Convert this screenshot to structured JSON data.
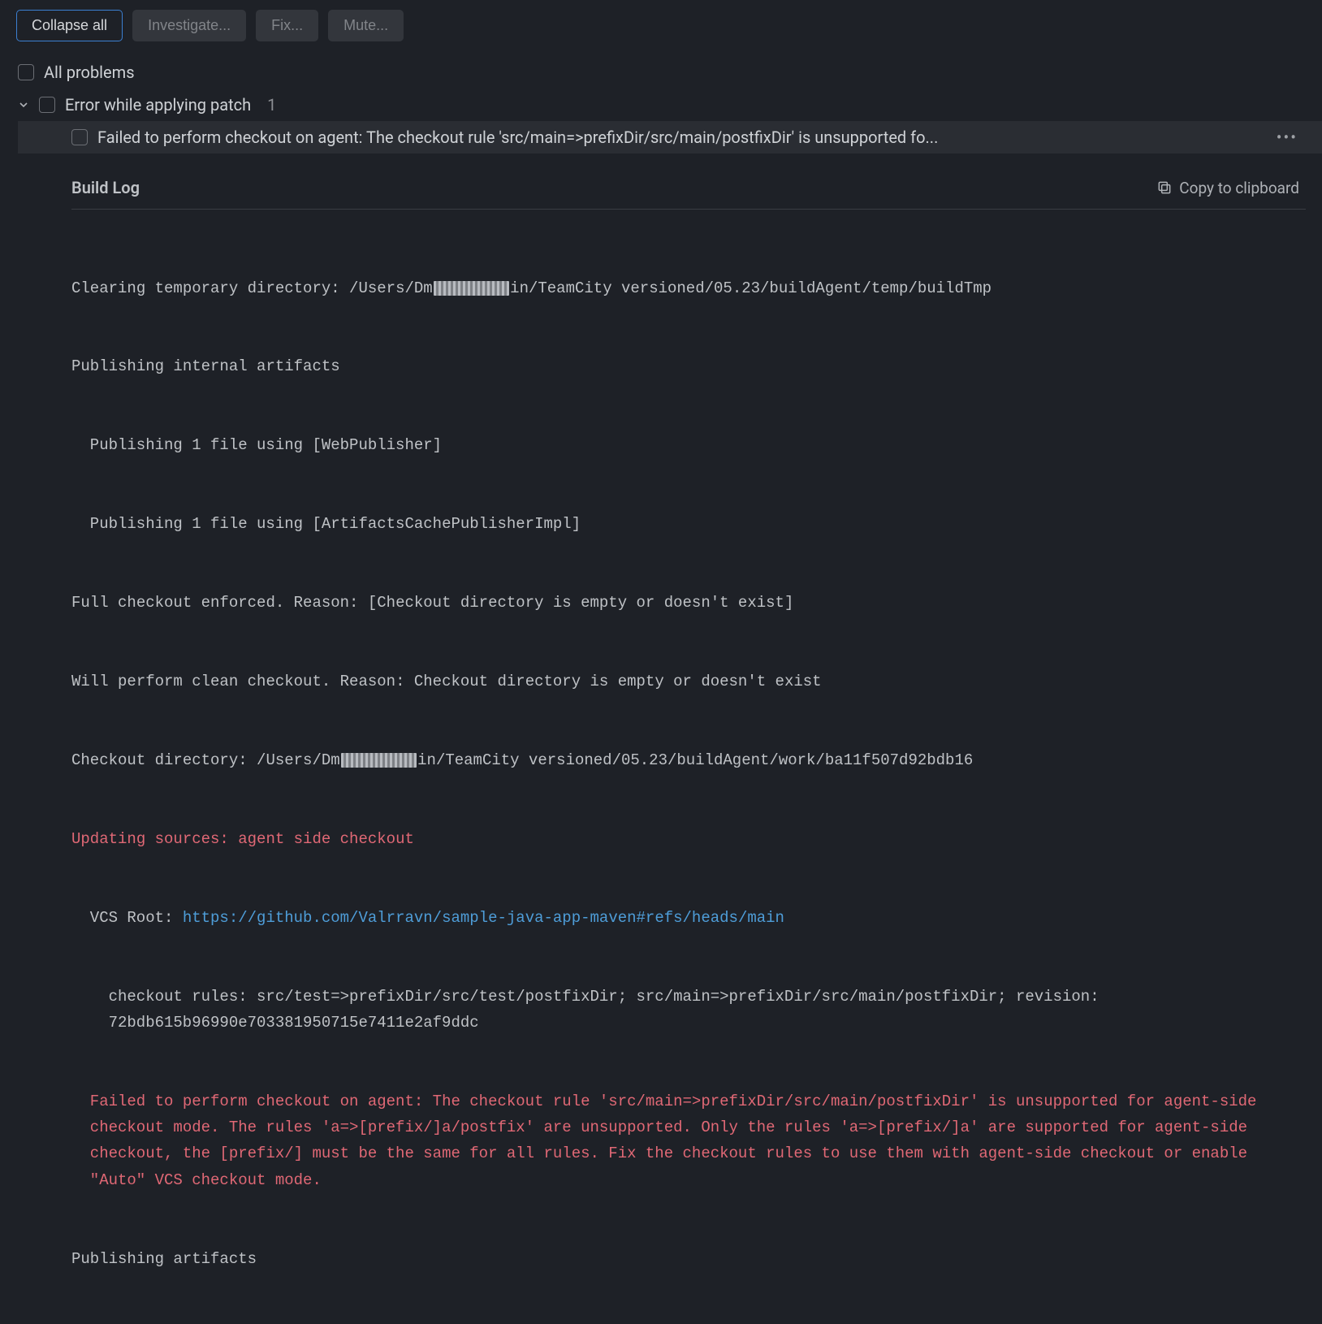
{
  "toolbar": {
    "collapse": "Collapse all",
    "investigate": "Investigate...",
    "fix": "Fix...",
    "mute": "Mute..."
  },
  "tree": {
    "all_problems": "All problems",
    "group": {
      "label": "Error while applying patch",
      "count": "1"
    },
    "item": {
      "text": "Failed to perform checkout on agent: The checkout rule 'src/main=>prefixDir/src/main/postfixDir' is unsupported fo..."
    }
  },
  "log": {
    "title": "Build Log",
    "copy": "Copy to clipboard",
    "lines": {
      "l1a": "Clearing temporary directory: /Users/Dm",
      "l1b": "in/TeamCity versioned/05.23/buildAgent/temp/buildTmp",
      "l2": "Publishing internal artifacts",
      "l3": "Publishing 1 file using [WebPublisher]",
      "l4": "Publishing 1 file using [ArtifactsCachePublisherImpl]",
      "l5": "Full checkout enforced. Reason: [Checkout directory is empty or doesn't exist]",
      "l6": "Will perform clean checkout. Reason: Checkout directory is empty or doesn't exist",
      "l7a": "Checkout directory: /Users/Dm",
      "l7b": "in/TeamCity versioned/05.23/buildAgent/work/ba11f507d92bdb16",
      "l8": "Updating sources: agent side checkout",
      "l9a": "VCS Root: ",
      "l9link": "https://github.com/Valrravn/sample-java-app-maven#refs/heads/main",
      "l10": "checkout rules: src/test=>prefixDir/src/test/postfixDir; src/main=>prefixDir/src/main/postfixDir; revision: 72bdb615b96990e703381950715e7411e2af9ddc",
      "l11": "Failed to perform checkout on agent: The checkout rule 'src/main=>prefixDir/src/main/postfixDir' is unsupported for agent-side checkout mode. The rules 'a=>[prefix/]a/postfix' are unsupported. Only the rules 'a=>[prefix/]a' are supported for agent-side checkout, the [prefix/] must be the same for all rules. Fix the checkout rules to use them with agent-side checkout or enable \"Auto\" VCS checkout mode.",
      "l12": "Publishing artifacts"
    }
  }
}
